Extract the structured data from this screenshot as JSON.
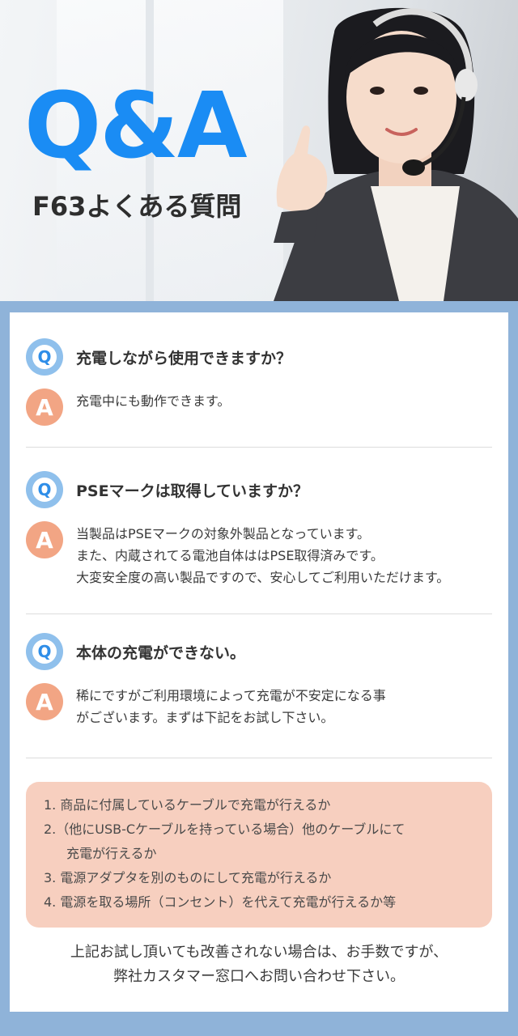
{
  "header": {
    "logo": "Q&A",
    "subtitle": "F63よくある質問"
  },
  "colors": {
    "logo_blue": "#1a8cf4",
    "q_badge": "#8fc0ec",
    "a_badge": "#f2a584",
    "tips_bg": "#f7cfbf",
    "frame": "#8fb3d9"
  },
  "badges": {
    "q": "Q",
    "a": "A"
  },
  "faq": [
    {
      "question": "充電しながら使用できますか？",
      "answer": [
        "充電中にも動作できます。"
      ]
    },
    {
      "question": "PSEマークは取得していますか？",
      "answer": [
        "当製品はPSEマークの対象外製品となっています。",
        "また、内蔵されてる電池自体ははPSE取得済みです。",
        "大変安全度の高い製品ですので、安心してご利用いただけます。"
      ]
    },
    {
      "question": "本体の充電ができない。",
      "answer": [
        "稀にですがご利用環境によって充電が不安定になる事",
        "がございます。まずは下記をお試し下さい。"
      ]
    }
  ],
  "tips": [
    "1. 商品に付属しているケーブルで充電が行えるか",
    "2.（他にUSB-Cケーブルを持っている場合）他のケーブルにて",
    "充電が行えるか",
    "3. 電源アダプタを別のものにして充電が行えるか",
    "4. 電源を取る場所（コンセント）を代えて充電が行えるか等"
  ],
  "closing": [
    "上記お試し頂いても改善されない場合は、お手数ですが、",
    "弊社カスタマー窓口へお問い合わせ下さい。"
  ]
}
